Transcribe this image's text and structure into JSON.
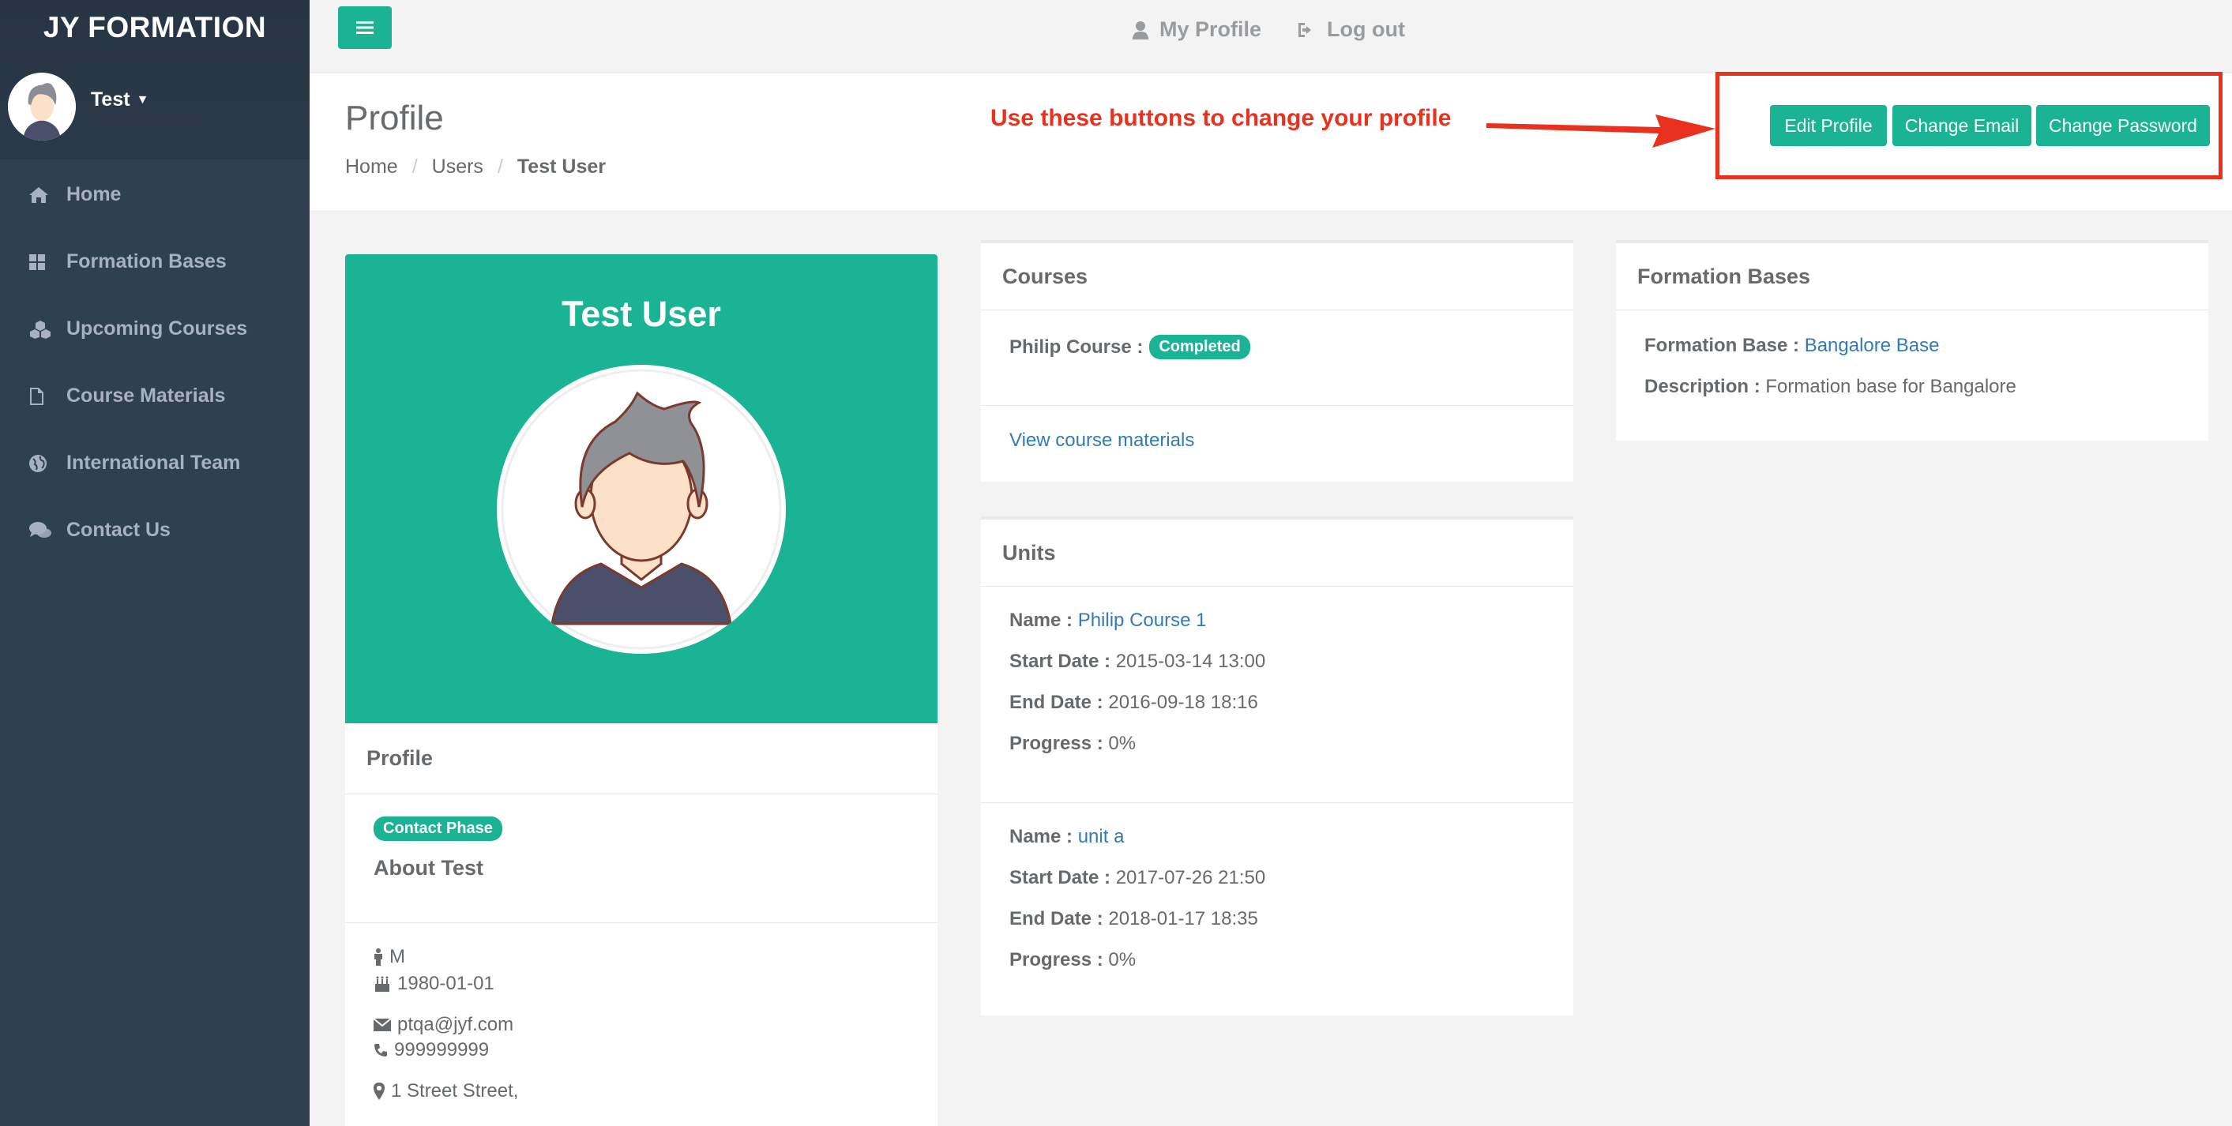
{
  "sidebar": {
    "brand": "JY FORMATION",
    "user": "Test",
    "items": [
      {
        "label": "Home",
        "icon": "home-icon"
      },
      {
        "label": "Formation Bases",
        "icon": "grid-icon"
      },
      {
        "label": "Upcoming Courses",
        "icon": "cubes-icon"
      },
      {
        "label": "Course Materials",
        "icon": "file-icon"
      },
      {
        "label": "International Team",
        "icon": "globe-icon"
      },
      {
        "label": "Contact Us",
        "icon": "chat-icon"
      }
    ]
  },
  "topbar": {
    "my_profile": "My Profile",
    "logout": "Log out"
  },
  "heading": {
    "title": "Profile",
    "breadcrumb": [
      "Home",
      "Users",
      "Test User"
    ],
    "annotation": "Use these buttons to change your profile",
    "buttons": {
      "edit_profile": "Edit Profile",
      "change_email": "Change Email",
      "change_password": "Change Password"
    }
  },
  "profile": {
    "name": "Test User",
    "section_title": "Profile",
    "phase_badge": "Contact Phase",
    "about": "About Test",
    "gender": "M",
    "birthdate": "1980-01-01",
    "email": "ptqa@jyf.com",
    "phone": "999999999",
    "address": "1 Street Street,"
  },
  "courses": {
    "title": "Courses",
    "course_label": "Philip Course :",
    "course_status": "Completed",
    "view_materials": "View course materials"
  },
  "units": {
    "title": "Units",
    "labels": {
      "name": "Name :",
      "start": "Start Date :",
      "end": "End Date :",
      "progress": "Progress :"
    },
    "items": [
      {
        "name": "Philip Course 1",
        "start": "2015-03-14 13:00",
        "end": "2016-09-18 18:16",
        "progress": "0%"
      },
      {
        "name": "unit a",
        "start": "2017-07-26 21:50",
        "end": "2018-01-17 18:35",
        "progress": "0%"
      }
    ]
  },
  "formation_bases": {
    "title": "Formation Bases",
    "base_label": "Formation Base :",
    "base_value": "Bangalore Base",
    "desc_label": "Description :",
    "desc_value": "Formation base for Bangalore"
  },
  "colors": {
    "accent": "#1ab394",
    "sidebar": "#2f4050",
    "annotation": "#e8311e",
    "link": "#337ab7"
  }
}
